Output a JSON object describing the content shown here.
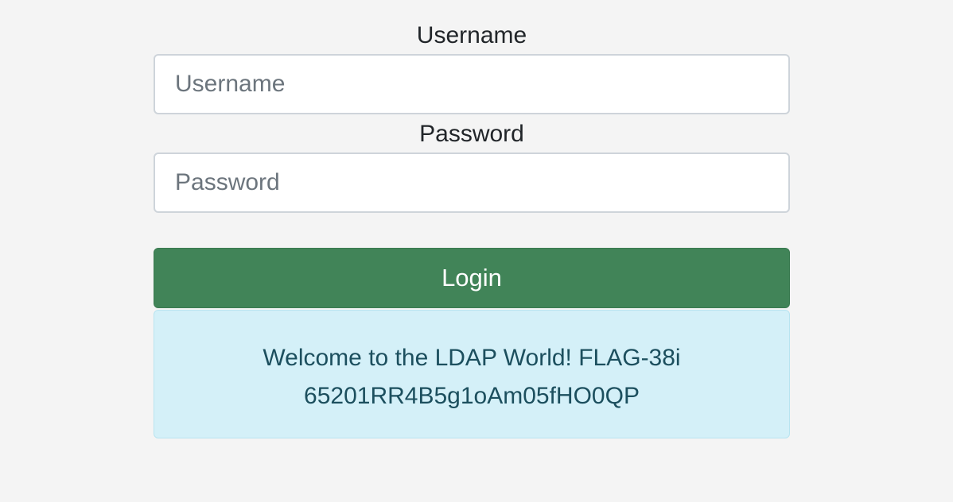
{
  "form": {
    "username_label": "Username",
    "username_placeholder": "Username",
    "username_value": "",
    "password_label": "Password",
    "password_placeholder": "Password",
    "password_value": "",
    "login_label": "Login"
  },
  "alert": {
    "message": "Welcome to the LDAP World! FLAG-38i65201RR4B5g1oAm05fHO0QP"
  },
  "colors": {
    "background": "#f4f4f4",
    "login_button": "#418458",
    "alert_background": "#d4f0f8",
    "alert_text": "#1c4f5e"
  }
}
